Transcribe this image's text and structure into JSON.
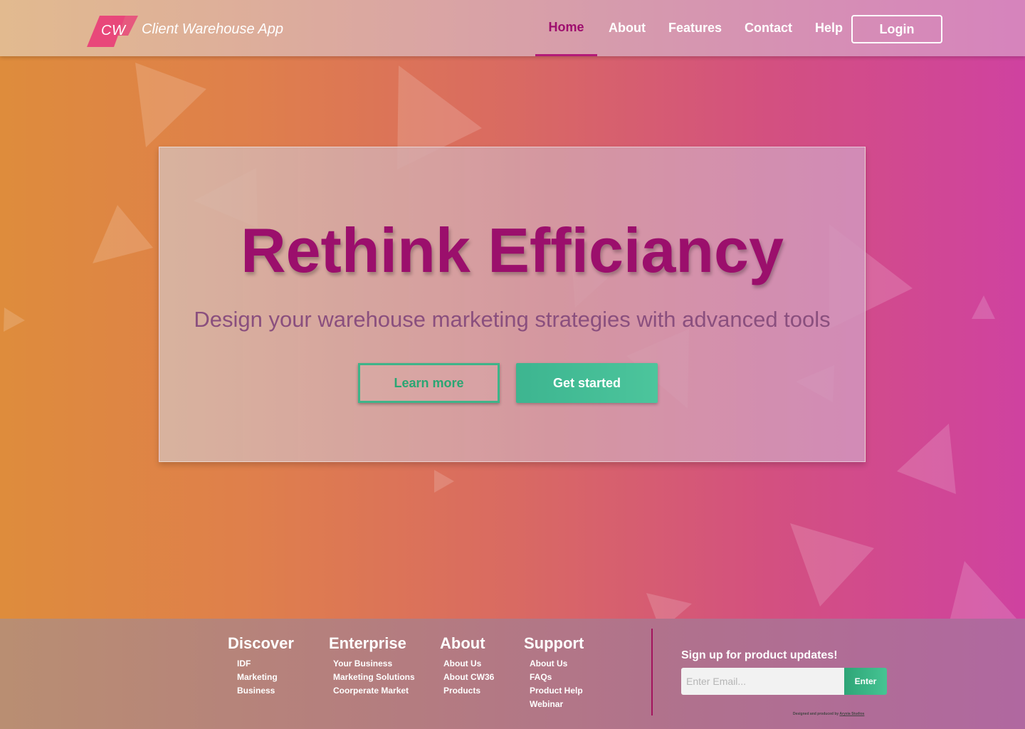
{
  "header": {
    "logo_text": "CW",
    "app_title": "Client Warehouse App",
    "nav": [
      {
        "label": "Home",
        "active": true
      },
      {
        "label": "About",
        "active": false
      },
      {
        "label": "Features",
        "active": false
      },
      {
        "label": "Contact",
        "active": false
      },
      {
        "label": "Help",
        "active": false
      }
    ],
    "login_label": "Login"
  },
  "hero": {
    "title": "Rethink Efficiancy",
    "subtitle": "Design your warehouse marketing strategies with advanced tools",
    "learn_more_label": "Learn more",
    "get_started_label": "Get started"
  },
  "footer": {
    "columns": [
      {
        "heading": "Discover",
        "links": [
          "IDF",
          "Marketing",
          "Business"
        ]
      },
      {
        "heading": "Enterprise",
        "links": [
          "Your Business",
          "Marketing Solutions",
          "Coorperate Market"
        ]
      },
      {
        "heading": "About",
        "links": [
          "About Us",
          "About CW36",
          "Products"
        ]
      },
      {
        "heading": "Support",
        "links": [
          "About Us",
          "FAQs",
          "Product Help",
          "Webinar"
        ]
      }
    ],
    "signup_label": "Sign up for product updates!",
    "email_placeholder": "Enter Email...",
    "enter_label": "Enter",
    "credit_prefix": "Designed and produced by",
    "credit_link": "Aryxia Studios"
  },
  "colors": {
    "brand_magenta": "#9b0f6c",
    "accent_green": "#3db590",
    "logo_pink": "#e8487a"
  }
}
